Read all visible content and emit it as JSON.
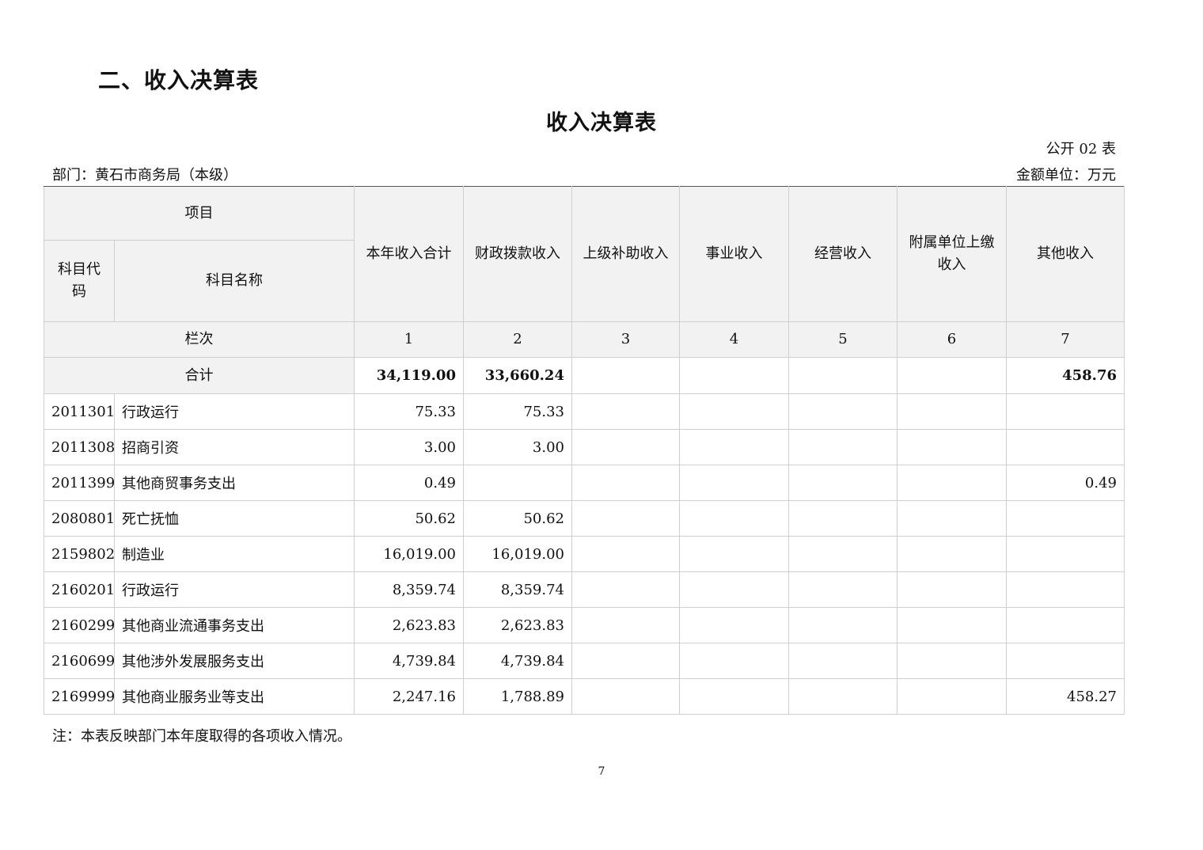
{
  "section_title": "二、收入决算表",
  "table_title": "收入决算表",
  "form_no": "公开 02 表",
  "department": "部门：黄石市商务局（本级）",
  "unit": "金额单位：万元",
  "headers": {
    "project": "项目",
    "code": "科目代码",
    "name": "科目名称",
    "columns": [
      "本年收入合计",
      "财政拨款收入",
      "上级补助收入",
      "事业收入",
      "经营收入",
      "附属单位上缴收入",
      "其他收入"
    ],
    "col_no_label": "栏次",
    "col_nos": [
      "1",
      "2",
      "3",
      "4",
      "5",
      "6",
      "7"
    ]
  },
  "total": {
    "label": "合计",
    "values": [
      "34,119.00",
      "33,660.24",
      "",
      "",
      "",
      "",
      "458.76"
    ]
  },
  "rows": [
    {
      "code": "2011301",
      "name": "行政运行",
      "values": [
        "75.33",
        "75.33",
        "",
        "",
        "",
        "",
        ""
      ]
    },
    {
      "code": "2011308",
      "name": "招商引资",
      "values": [
        "3.00",
        "3.00",
        "",
        "",
        "",
        "",
        ""
      ]
    },
    {
      "code": "2011399",
      "name": "其他商贸事务支出",
      "values": [
        "0.49",
        "",
        "",
        "",
        "",
        "",
        "0.49"
      ]
    },
    {
      "code": "2080801",
      "name": "死亡抚恤",
      "values": [
        "50.62",
        "50.62",
        "",
        "",
        "",
        "",
        ""
      ]
    },
    {
      "code": "2159802",
      "name": "制造业",
      "values": [
        "16,019.00",
        "16,019.00",
        "",
        "",
        "",
        "",
        ""
      ]
    },
    {
      "code": "2160201",
      "name": "行政运行",
      "values": [
        "8,359.74",
        "8,359.74",
        "",
        "",
        "",
        "",
        ""
      ]
    },
    {
      "code": "2160299",
      "name": "其他商业流通事务支出",
      "values": [
        "2,623.83",
        "2,623.83",
        "",
        "",
        "",
        "",
        ""
      ]
    },
    {
      "code": "2160699",
      "name": "其他涉外发展服务支出",
      "values": [
        "4,739.84",
        "4,739.84",
        "",
        "",
        "",
        "",
        ""
      ]
    },
    {
      "code": "2169999",
      "name": "其他商业服务业等支出",
      "values": [
        "2,247.16",
        "1,788.89",
        "",
        "",
        "",
        "",
        "458.27"
      ]
    }
  ],
  "note": "注：本表反映部门本年度取得的各项收入情况。",
  "page_number": "7"
}
